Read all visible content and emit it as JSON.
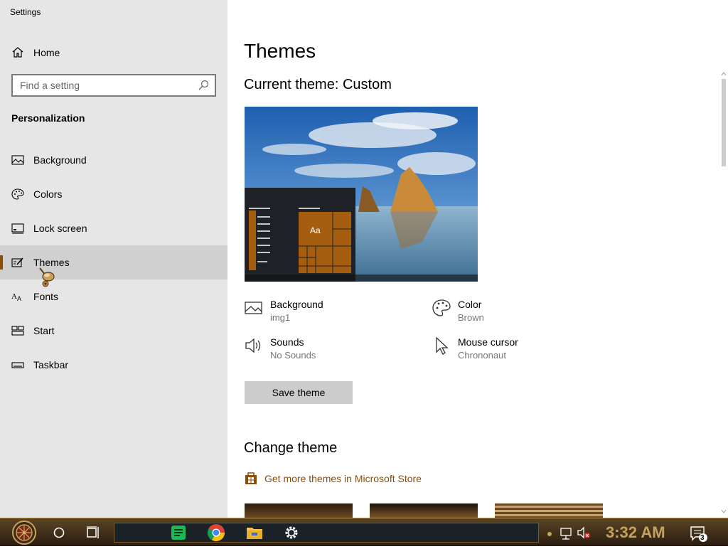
{
  "window": {
    "app_title": "Settings",
    "controls": {
      "minimize": "minimize-icon",
      "restore": "restore-icon",
      "close": "close-icon"
    }
  },
  "sidebar": {
    "home_label": "Home",
    "search": {
      "placeholder": "Find a setting",
      "value": ""
    },
    "section_title": "Personalization",
    "items": [
      {
        "label": "Background",
        "icon": "picture-icon",
        "active": false
      },
      {
        "label": "Colors",
        "icon": "palette-icon",
        "active": false
      },
      {
        "label": "Lock screen",
        "icon": "lock-screen-icon",
        "active": false
      },
      {
        "label": "Themes",
        "icon": "themes-icon",
        "active": true
      },
      {
        "label": "Fonts",
        "icon": "fonts-icon",
        "active": false
      },
      {
        "label": "Start",
        "icon": "start-icon",
        "active": false
      },
      {
        "label": "Taskbar",
        "icon": "taskbar-icon",
        "active": false
      }
    ]
  },
  "main": {
    "page_title": "Themes",
    "current_theme": "Current theme: Custom",
    "preview_tile_text": "Aa",
    "properties": {
      "background": {
        "name": "Background",
        "value": "img1"
      },
      "color": {
        "name": "Color",
        "value": "Brown"
      },
      "sounds": {
        "name": "Sounds",
        "value": "No Sounds"
      },
      "mouse_cursor": {
        "name": "Mouse cursor",
        "value": "Chrononaut"
      }
    },
    "save_button": "Save theme",
    "change_theme_title": "Change theme",
    "store_link": "Get more themes in Microsoft Store"
  },
  "taskbar": {
    "clock": "3:32 AM",
    "notification_count": "3",
    "apps": [
      "start-orb-icon",
      "cortana-icon",
      "task-view-icon",
      "notes-app-icon",
      "chrome-icon",
      "file-explorer-icon",
      "settings-icon"
    ]
  },
  "colors": {
    "accent": "#8b4d0c",
    "sidebar_bg": "#e6e6e6",
    "active_item_bg": "#d0d0d0",
    "secondary_text": "#767676"
  }
}
